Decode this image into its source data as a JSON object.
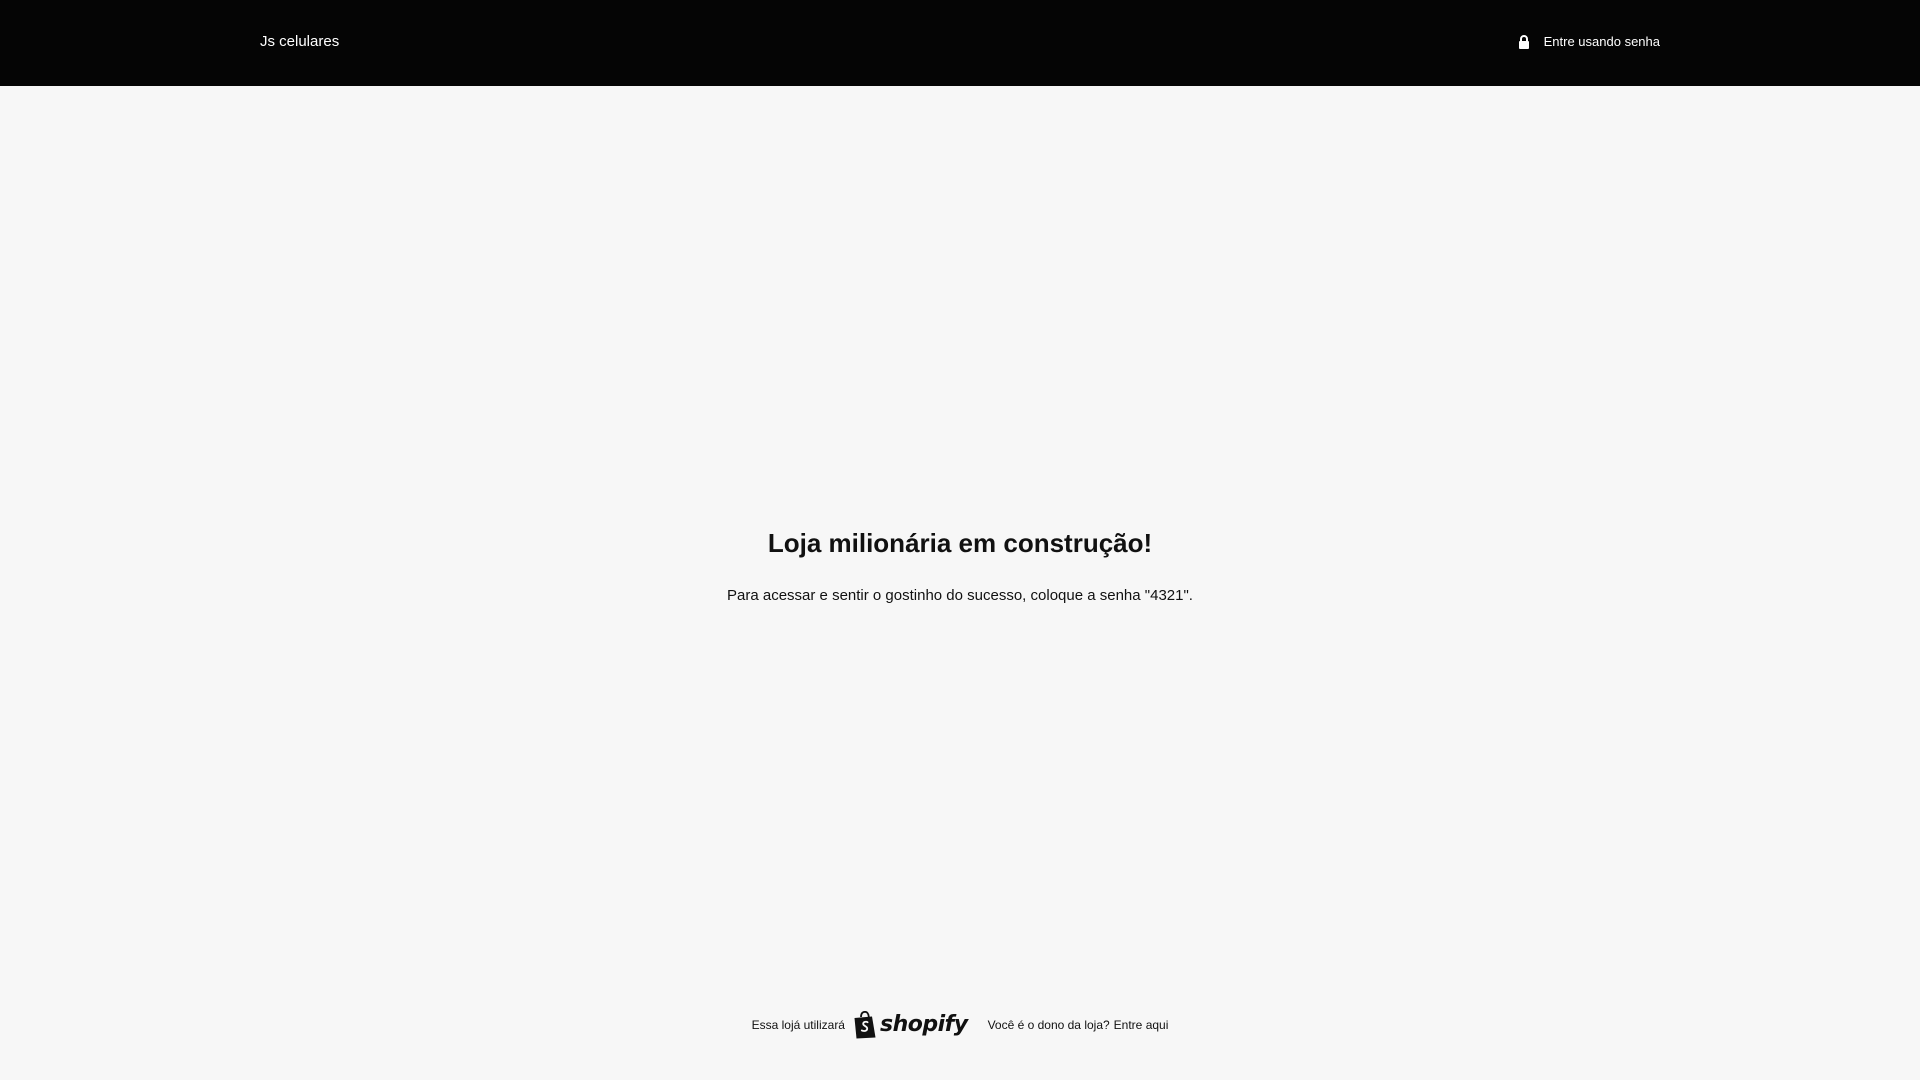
{
  "header": {
    "store_name": "Js celulares",
    "login_label": "Entre usando senha"
  },
  "main": {
    "title": "Loja milionária em construção!",
    "message": "Para acessar e sentir o gostinho do sucesso, coloque a senha \"4321\"."
  },
  "footer": {
    "powered_prefix": "Essa lojá utilizará",
    "brand": "shopify",
    "owner_question": "Você é o dono da loja?",
    "owner_link": "Entre aqui"
  },
  "icons": {
    "login": "lock-icon",
    "brand": "shopify-bag-icon"
  },
  "colors": {
    "header_bg": "#050505",
    "page_bg": "#f7f7f7",
    "text": "#111111"
  }
}
